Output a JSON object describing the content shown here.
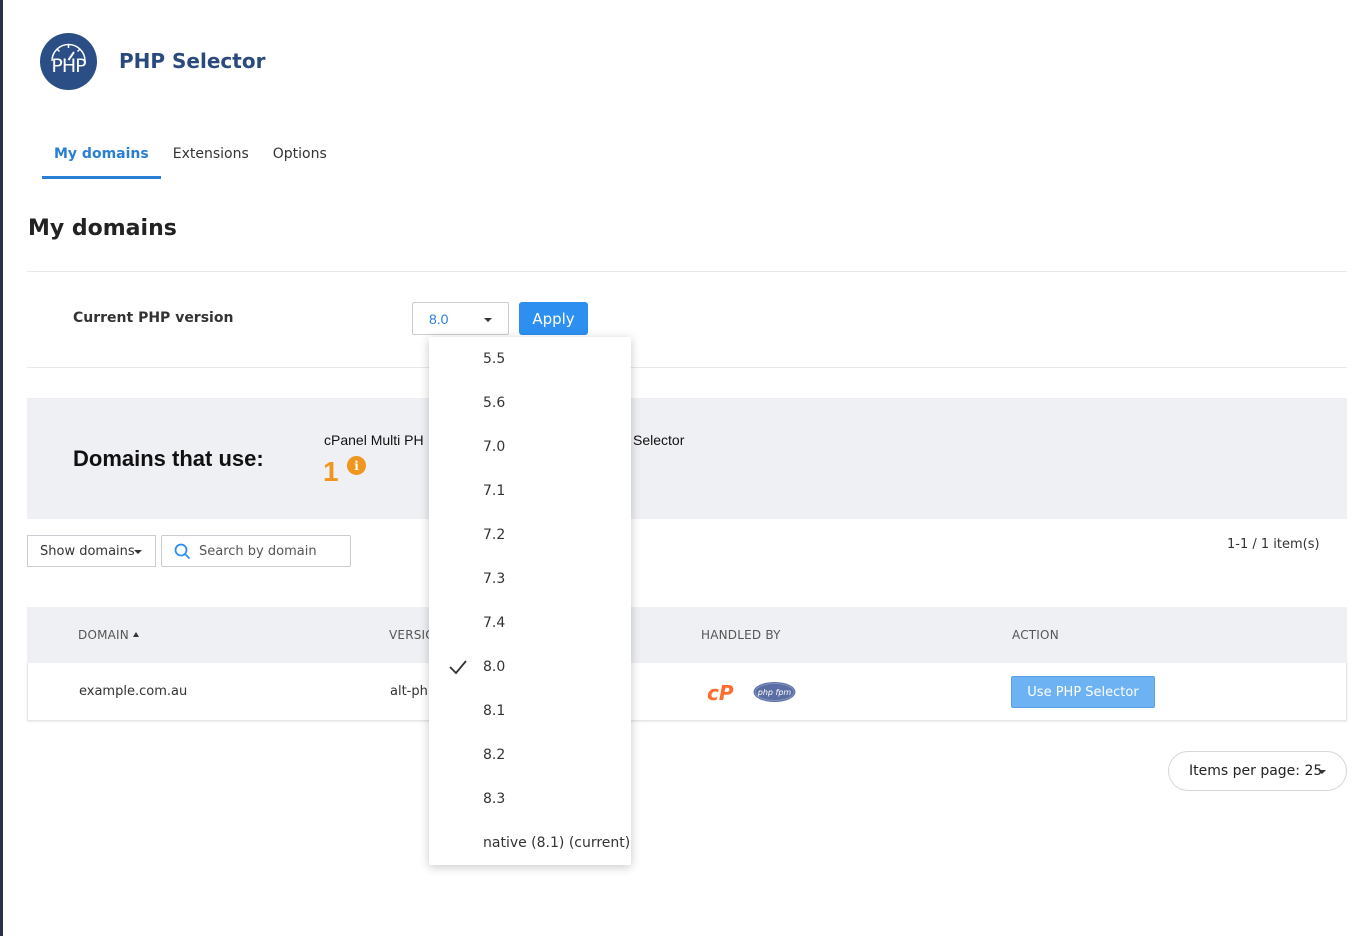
{
  "header": {
    "logo_text": "PHP",
    "title": "PHP Selector"
  },
  "tabs": [
    {
      "label": "My domains",
      "active": true
    },
    {
      "label": "Extensions",
      "active": false
    },
    {
      "label": "Options",
      "active": false
    }
  ],
  "page": {
    "heading": "My domains"
  },
  "php_version": {
    "label": "Current PHP version",
    "selected": "8.0",
    "apply_label": "Apply",
    "options": [
      "5.5",
      "5.6",
      "7.0",
      "7.1",
      "7.2",
      "7.3",
      "7.4",
      "8.0",
      "8.1",
      "8.2",
      "8.3",
      "native (8.1) (current)"
    ]
  },
  "domains_panel": {
    "title": "Domains that use:",
    "handler_text_left": "cPanel Multi PH",
    "handler_text_right": "Selector",
    "count": "1",
    "info_icon": "i"
  },
  "filters": {
    "show_domains_label": "Show domains",
    "search_placeholder": "Search by domain",
    "search_value": "",
    "pager_count": "1-1 / 1 item(s)"
  },
  "table": {
    "columns": [
      "DOMAIN",
      "VERSIO",
      "HANDLED BY",
      "ACTION"
    ],
    "rows": [
      {
        "domain": "example.com.au",
        "version": "alt-php",
        "handled_by": [
          "cpanel-icon",
          "php-fpm-icon"
        ],
        "action_label": "Use PHP Selector"
      }
    ]
  },
  "pagination": {
    "items_per_page_label": "Items per page: 25"
  },
  "icons": {
    "cpanel_logo_text": "cP",
    "fpm_logo_text": "php fpm"
  },
  "colors": {
    "accent": "#2d8ff0",
    "brand": "#2b4e87",
    "warning": "#f0961f",
    "cpanel": "#ff6c2c"
  }
}
